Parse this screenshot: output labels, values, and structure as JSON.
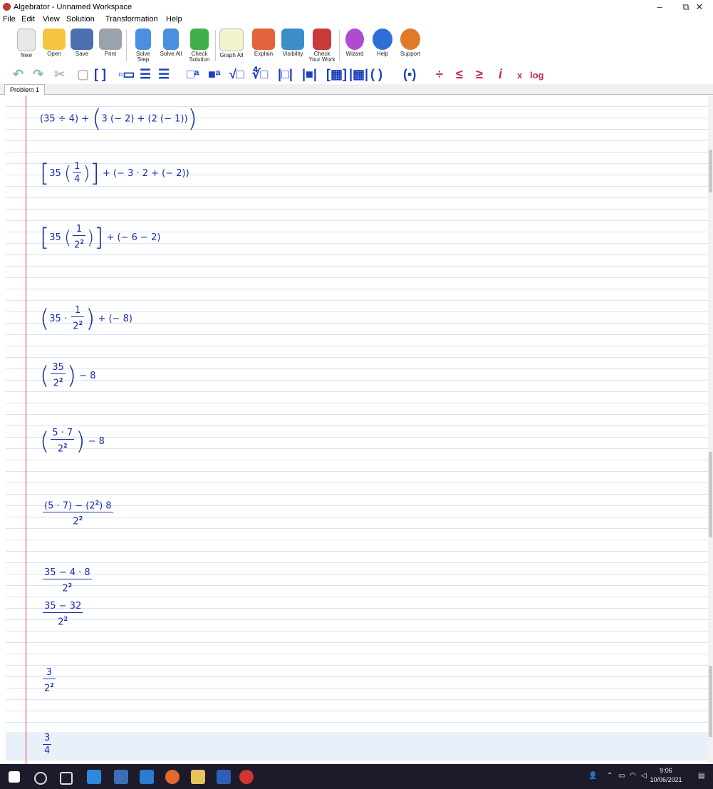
{
  "window": {
    "title": "Algebrator - Unnamed Workspace",
    "minimize": "–",
    "restore": "⧉",
    "close": "✕"
  },
  "menu": [
    "File",
    "Edit",
    "View",
    "Solution",
    "Transformation",
    "Help"
  ],
  "toolbar": {
    "new": "New",
    "open": "Open",
    "save": "Save",
    "print": "Print",
    "solve_step": "Solve Step",
    "solve_all": "Solve All",
    "check_solution": "Check Solution",
    "graph_all": "Graph All",
    "explain": "Explain",
    "visibility": "Visibility",
    "check_your_work": "Check Your Work",
    "wizard": "Wizard",
    "help": "Help",
    "support": "Support"
  },
  "math_toolbar": {
    "parens": "( )",
    "divide": "÷",
    "leq": "≤",
    "geq": "≥",
    "imag": "i",
    "subscript": "x",
    "log": "log"
  },
  "tab": {
    "label": "Problem 1"
  },
  "steps": {
    "s1": {
      "a": "(35 ÷ 4) +",
      "b": "3 (− 2) + (2 (− 1))"
    },
    "s2": {
      "a": "35",
      "num": "1",
      "den": "4",
      "b": "+ (− 3 · 2 + (− 2))"
    },
    "s3": {
      "a": "35",
      "num": "1",
      "den": "2",
      "b": "+ (− 6 − 2)"
    },
    "s4": {
      "a": "35 ·",
      "num": "1",
      "den": "2",
      "b": "+ (− 8)"
    },
    "s5": {
      "num": "35",
      "den": "2",
      "b": "− 8"
    },
    "s6": {
      "num": "5 · 7",
      "den": "2",
      "b": "− 8"
    },
    "s7": {
      "num": "(5 · 7) − (2",
      "num2": ") 8",
      "den": "2"
    },
    "s8": {
      "num": "35 − 4 · 8",
      "den": "2"
    },
    "s9": {
      "num": "35 − 32",
      "den": "2"
    },
    "s10": {
      "num": "3",
      "den": "2"
    },
    "s11": {
      "num": "3",
      "den": "4"
    }
  },
  "exponent": "2",
  "taskbar": {
    "time": "9:06",
    "date": "10/06/2021"
  }
}
